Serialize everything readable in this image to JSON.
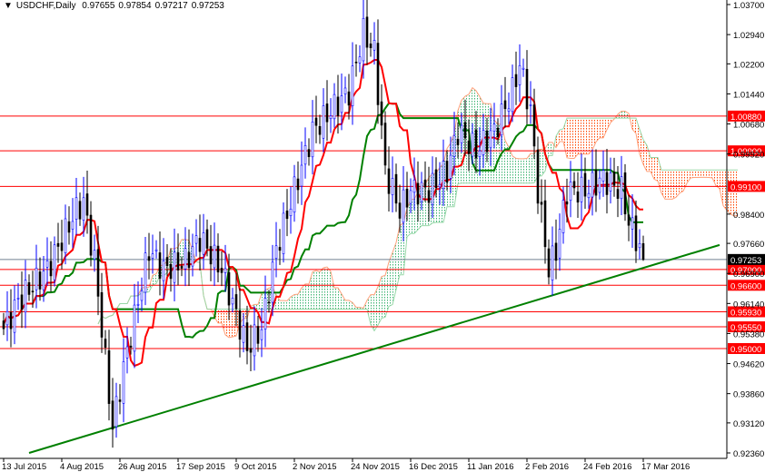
{
  "header": {
    "symbol": "USDCHF,Daily",
    "open": "0.97655",
    "high": "0.97854",
    "low": "0.97217",
    "close": "0.97253"
  },
  "chart_data": {
    "type": "candlestick",
    "symbol": "USDCHF",
    "timeframe": "Daily",
    "ylim": [
      0.9236,
      1.037
    ],
    "y_ticks": [
      "1.03700",
      "1.02940",
      "1.02200",
      "1.01440",
      "1.00680",
      "0.99920",
      "0.98400",
      "0.97660",
      "0.96900",
      "0.96140",
      "0.95380",
      "0.94620",
      "0.93860",
      "0.93120",
      "0.92360"
    ],
    "x_ticks": [
      {
        "day": 0,
        "label": "13 Jul 2015"
      },
      {
        "day": 16,
        "label": "4 Aug 2015"
      },
      {
        "day": 32,
        "label": "26 Aug 2015"
      },
      {
        "day": 48,
        "label": "17 Sep 2015"
      },
      {
        "day": 64,
        "label": "9 Oct 2015"
      },
      {
        "day": 80,
        "label": "2 Nov 2015"
      },
      {
        "day": 96,
        "label": "24 Nov 2015"
      },
      {
        "day": 112,
        "label": "16 Dec 2015"
      },
      {
        "day": 128,
        "label": "11 Jan 2016"
      },
      {
        "day": 144,
        "label": "2 Feb 2016"
      },
      {
        "day": 160,
        "label": "24 Feb 2016"
      },
      {
        "day": 176,
        "label": "17 Mar 2016"
      }
    ],
    "close_waypoints": [
      [
        0,
        0.955
      ],
      [
        4,
        0.962
      ],
      [
        12,
        0.97
      ],
      [
        20,
        0.985
      ],
      [
        22,
        0.987
      ],
      [
        25,
        0.972
      ],
      [
        30,
        0.93
      ],
      [
        33,
        0.945
      ],
      [
        40,
        0.975
      ],
      [
        44,
        0.97
      ],
      [
        50,
        0.972
      ],
      [
        54,
        0.978
      ],
      [
        60,
        0.97
      ],
      [
        67,
        0.95
      ],
      [
        71,
        0.955
      ],
      [
        75,
        0.975
      ],
      [
        80,
        0.99
      ],
      [
        85,
        1.005
      ],
      [
        90,
        1.01
      ],
      [
        95,
        1.015
      ],
      [
        99,
        1.03
      ],
      [
        102,
        1.025
      ],
      [
        105,
        0.995
      ],
      [
        109,
        0.985
      ],
      [
        112,
        0.99
      ],
      [
        117,
        0.99
      ],
      [
        122,
        0.995
      ],
      [
        125,
        1.005
      ],
      [
        130,
        1.0
      ],
      [
        135,
        1.005
      ],
      [
        140,
        1.015
      ],
      [
        142,
        1.022
      ],
      [
        145,
        1.01
      ],
      [
        147,
        0.99
      ],
      [
        150,
        0.97
      ],
      [
        152,
        0.975
      ],
      [
        155,
        0.99
      ],
      [
        160,
        0.99
      ],
      [
        165,
        0.993
      ],
      [
        170,
        0.99
      ],
      [
        172,
        0.982
      ],
      [
        174,
        0.978
      ],
      [
        176,
        0.97253
      ]
    ],
    "levels": [
      {
        "price": 1.0088,
        "label": "1.00880"
      },
      {
        "price": 1.0,
        "label": "1.00000"
      },
      {
        "price": 0.991,
        "label": "0.99100"
      },
      {
        "price": 0.97,
        "label": "0.97000"
      },
      {
        "price": 0.966,
        "label": "0.96600"
      },
      {
        "price": 0.9593,
        "label": "0.95930"
      },
      {
        "price": 0.9555,
        "label": "0.95550"
      },
      {
        "price": 0.95,
        "label": "0.95000"
      }
    ],
    "current_price": {
      "price": 0.97253,
      "label": "0.97253"
    },
    "trendline": [
      [
        7,
        0.9236
      ],
      [
        197,
        0.9762
      ]
    ],
    "indicators": [
      "Ichimoku Tenkan-sen (red)",
      "Kijun-sen (green)",
      "Kumo cloud (dotted)"
    ],
    "colors": {
      "level": "#ff0000",
      "tenkan": "#ff0000",
      "kijun": "#008000",
      "trend": "#008000",
      "up": "#0000ff",
      "down": "#000000",
      "cloud_up": "#3cb371",
      "cloud_down": "#ff4500",
      "current": "#708090"
    }
  }
}
